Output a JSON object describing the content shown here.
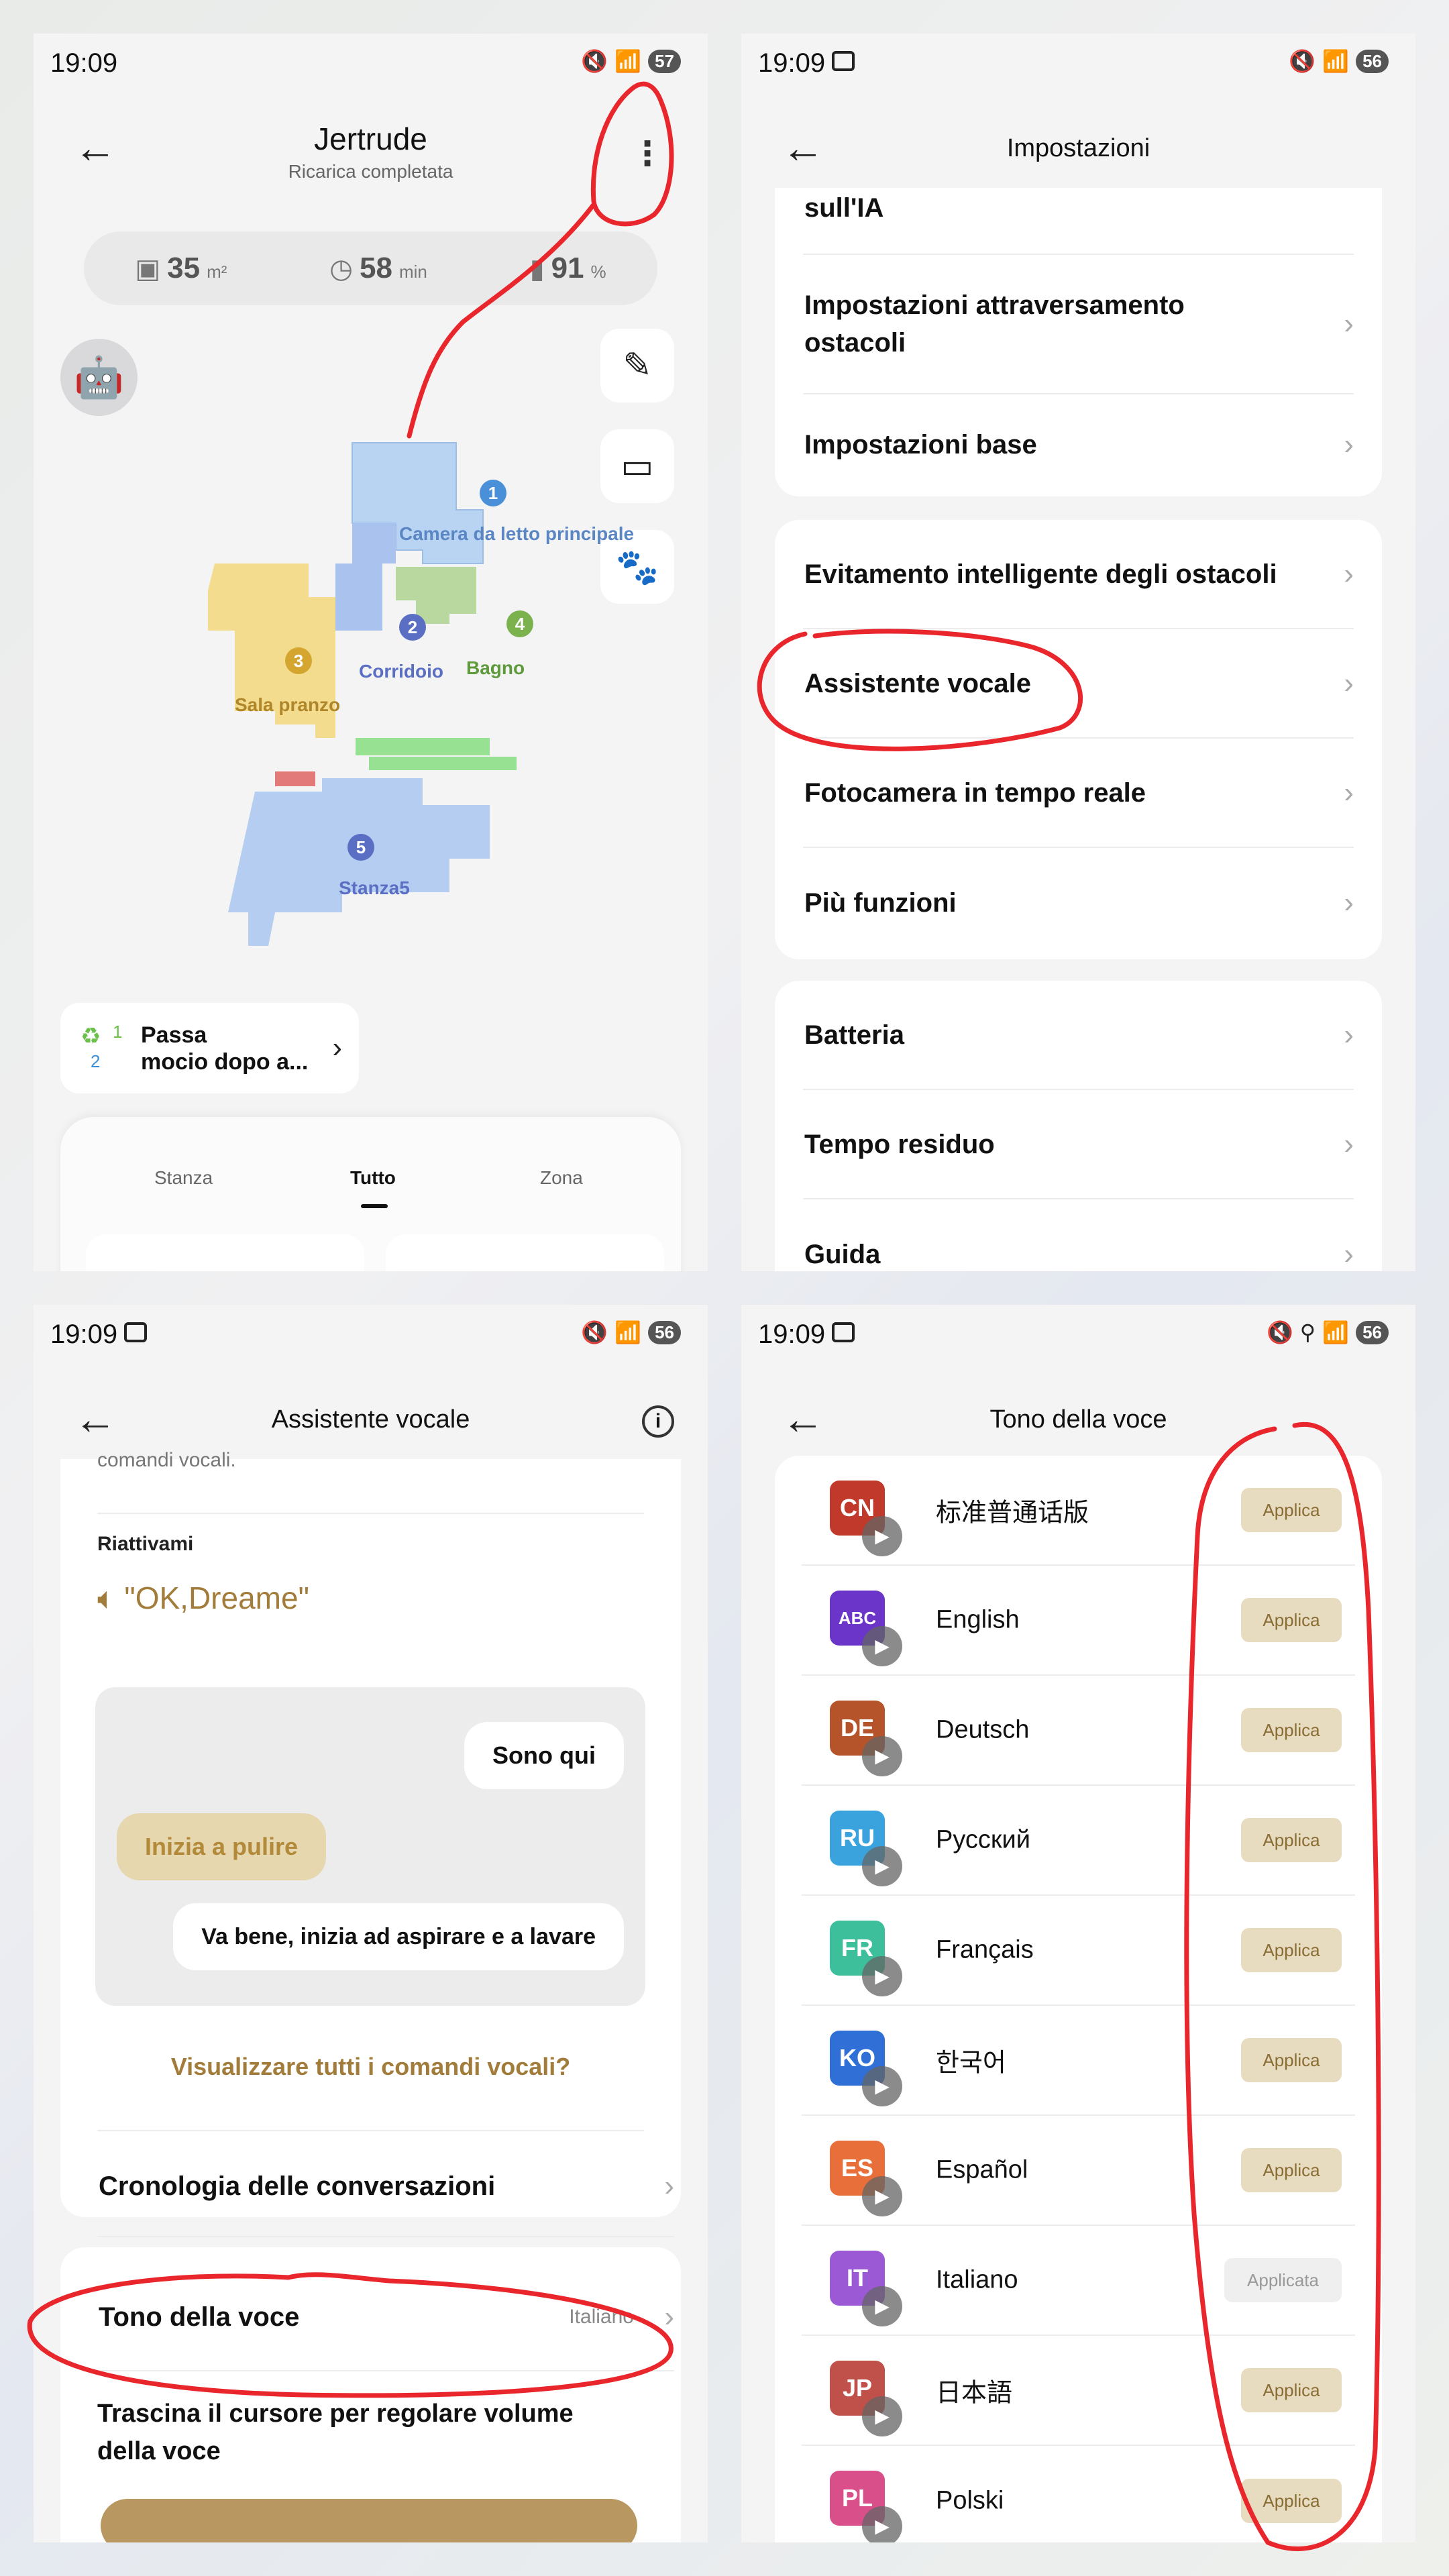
{
  "panel1": {
    "status": {
      "time": "19:09",
      "battery": "57"
    },
    "title": "Jertrude",
    "subtitle": "Ricarica completata",
    "stats": {
      "area": "35",
      "area_unit": "m²",
      "time": "58",
      "time_unit": "min",
      "battery": "91",
      "battery_unit": "%"
    },
    "rooms": {
      "r1": "Camera da letto principale",
      "r2": "Corridoio",
      "r3": "Sala pranzo",
      "r4": "Bagno",
      "r5": "Stanza5"
    },
    "room_numbers": {
      "n1": "1",
      "n2": "2",
      "n3": "3",
      "n4": "4",
      "n5": "5"
    },
    "mop_badge": {
      "a": "1",
      "b": "2"
    },
    "mop": "Passa\nmocio dopo a...",
    "tabs": {
      "stanza": "Stanza",
      "tutto": "Tutto",
      "zona": "Zona"
    }
  },
  "panel2": {
    "status": {
      "time": "19:09",
      "battery": "56"
    },
    "title": "Impostazioni",
    "group1": [
      "sull'IA",
      "Impostazioni attraversamento ostacoli",
      "Impostazioni base"
    ],
    "group2": [
      "Evitamento intelligente degli ostacoli",
      "Assistente vocale",
      "Fotocamera in tempo reale",
      "Più funzioni"
    ],
    "group3": [
      "Batteria",
      "Tempo residuo",
      "Guida"
    ]
  },
  "panel3": {
    "status": {
      "time": "19:09",
      "battery": "56"
    },
    "title": "Assistente vocale",
    "snippet": "comandi vocali.",
    "wake_title": "Riattivami",
    "wake_phrase": "\"OK,Dreame\"",
    "chat": {
      "robot1": "Sono qui",
      "user": "Inizia a pulire",
      "robot2": "Va bene, inizia ad aspirare e a lavare"
    },
    "all_commands": "Visualizzare tutti i comandi vocali?",
    "history": "Cronologia delle conversazioni",
    "voice_tone": "Tono della voce",
    "voice_tone_value": "Italiano",
    "volume": "Trascina il cursore per regolare volume della voce"
  },
  "panel4": {
    "status": {
      "time": "19:09",
      "battery": "56"
    },
    "title": "Tono della voce",
    "languages": [
      {
        "code": "CN",
        "name": "标准普通话版",
        "action": "Applica",
        "color": "#c0392b"
      },
      {
        "code": "ABC",
        "name": "English",
        "action": "Applica",
        "color": "#6a35c8"
      },
      {
        "code": "DE",
        "name": "Deutsch",
        "action": "Applica",
        "color": "#b5532b"
      },
      {
        "code": "RU",
        "name": "Русский",
        "action": "Applica",
        "color": "#3aa3dd"
      },
      {
        "code": "FR",
        "name": "Français",
        "action": "Applica",
        "color": "#3cbf9a"
      },
      {
        "code": "KO",
        "name": "한국어",
        "action": "Applica",
        "color": "#2f6fd6"
      },
      {
        "code": "ES",
        "name": "Español",
        "action": "Applica",
        "color": "#e86f3a"
      },
      {
        "code": "IT",
        "name": "Italiano",
        "action": "Applicata",
        "color": "#9b59d6"
      },
      {
        "code": "JP",
        "name": "日本語",
        "action": "Applica",
        "color": "#c0504a"
      },
      {
        "code": "PL",
        "name": "Polski",
        "action": "Applica",
        "color": "#d94f8a"
      }
    ]
  }
}
